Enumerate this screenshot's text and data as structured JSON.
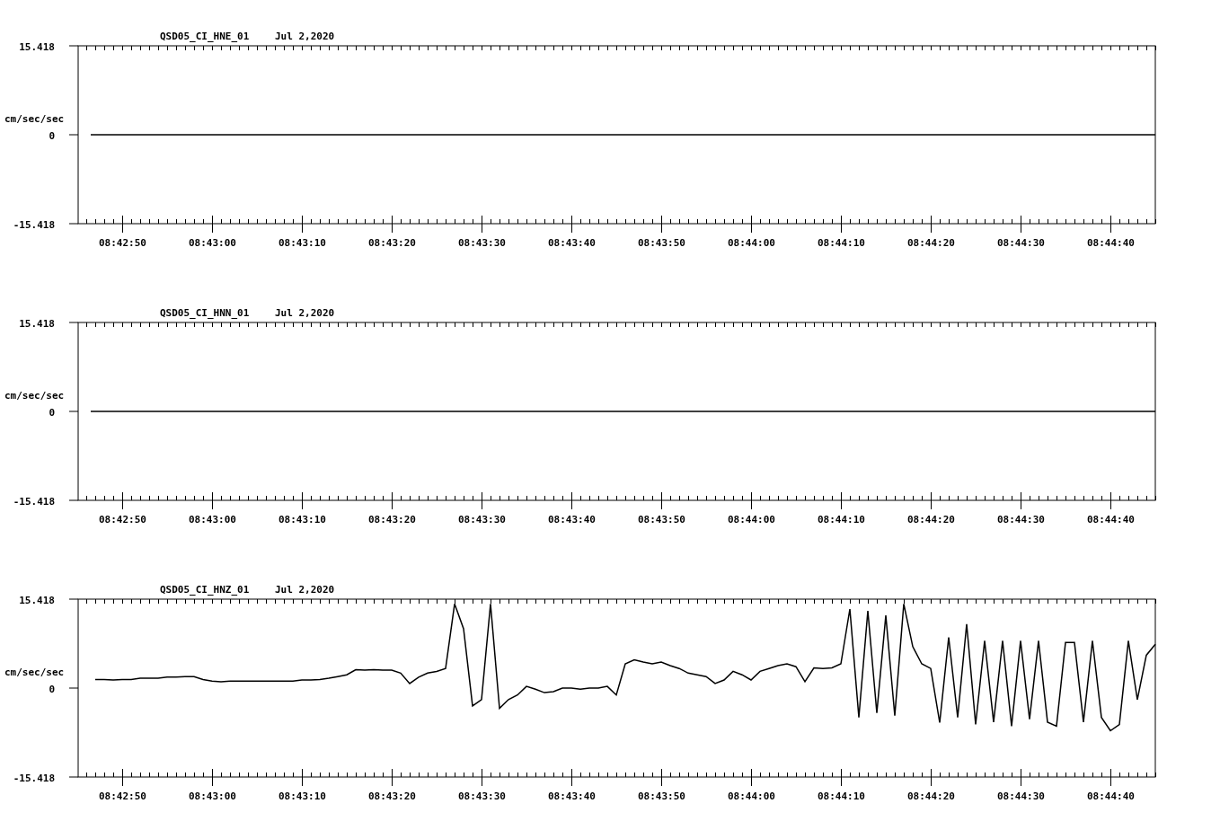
{
  "panels": [
    {
      "station": "QSD05_CI_HNE_01",
      "date": "Jul 2,2020",
      "chart_data": {
        "type": "line",
        "ylabel": "cm/sec/sec",
        "xlim": [
          31365.1,
          31485
        ],
        "ylim": [
          -15.418,
          15.418
        ],
        "yticks": [
          {
            "value": 15.418,
            "label": "15.418"
          },
          {
            "value": 0,
            "label": "0"
          },
          {
            "value": -15.418,
            "label": "-15.418"
          }
        ],
        "xticks": [
          {
            "value": 31370,
            "label": "08:42:50"
          },
          {
            "value": 31380,
            "label": "08:43:00"
          },
          {
            "value": 31390,
            "label": "08:43:10"
          },
          {
            "value": 31400,
            "label": "08:43:20"
          },
          {
            "value": 31410,
            "label": "08:43:30"
          },
          {
            "value": 31420,
            "label": "08:43:40"
          },
          {
            "value": 31430,
            "label": "08:43:50"
          },
          {
            "value": 31440,
            "label": "08:44:00"
          },
          {
            "value": 31450,
            "label": "08:44:10"
          },
          {
            "value": 31460,
            "label": "08:44:20"
          },
          {
            "value": 31470,
            "label": "08:44:30"
          },
          {
            "value": 31480,
            "label": "08:44:40"
          }
        ],
        "x": [
          31366.5,
          31485
        ],
        "series": [
          {
            "color": "#000000",
            "values": [
              0,
              0
            ]
          }
        ]
      }
    },
    {
      "station": "QSD05_CI_HNN_01",
      "date": "Jul 2,2020",
      "chart_data": {
        "type": "line",
        "ylabel": "cm/sec/sec",
        "xlim": [
          31365.1,
          31485
        ],
        "ylim": [
          -15.418,
          15.418
        ],
        "yticks": [
          {
            "value": 15.418,
            "label": "15.418"
          },
          {
            "value": 0,
            "label": "0"
          },
          {
            "value": -15.418,
            "label": "-15.418"
          }
        ],
        "xticks": [
          {
            "value": 31370,
            "label": "08:42:50"
          },
          {
            "value": 31380,
            "label": "08:43:00"
          },
          {
            "value": 31390,
            "label": "08:43:10"
          },
          {
            "value": 31400,
            "label": "08:43:20"
          },
          {
            "value": 31410,
            "label": "08:43:30"
          },
          {
            "value": 31420,
            "label": "08:43:40"
          },
          {
            "value": 31430,
            "label": "08:43:50"
          },
          {
            "value": 31440,
            "label": "08:44:00"
          },
          {
            "value": 31450,
            "label": "08:44:10"
          },
          {
            "value": 31460,
            "label": "08:44:20"
          },
          {
            "value": 31470,
            "label": "08:44:30"
          },
          {
            "value": 31480,
            "label": "08:44:40"
          }
        ],
        "x": [
          31366.5,
          31485
        ],
        "series": [
          {
            "color": "#000000",
            "values": [
              0,
              0
            ]
          }
        ]
      }
    },
    {
      "station": "QSD05_CI_HNZ_01",
      "date": "Jul 2,2020",
      "chart_data": {
        "type": "line",
        "ylabel": "cm/sec/sec",
        "xlim": [
          31365.1,
          31485
        ],
        "ylim": [
          -15.418,
          15.418
        ],
        "yticks": [
          {
            "value": 15.418,
            "label": "15.418"
          },
          {
            "value": 0,
            "label": "0"
          },
          {
            "value": -15.418,
            "label": "-15.418"
          }
        ],
        "xticks": [
          {
            "value": 31370,
            "label": "08:42:50"
          },
          {
            "value": 31380,
            "label": "08:43:00"
          },
          {
            "value": 31390,
            "label": "08:43:10"
          },
          {
            "value": 31400,
            "label": "08:43:20"
          },
          {
            "value": 31410,
            "label": "08:43:30"
          },
          {
            "value": 31420,
            "label": "08:43:40"
          },
          {
            "value": 31430,
            "label": "08:43:50"
          },
          {
            "value": 31440,
            "label": "08:44:00"
          },
          {
            "value": 31450,
            "label": "08:44:10"
          },
          {
            "value": 31460,
            "label": "08:44:20"
          },
          {
            "value": 31470,
            "label": "08:44:30"
          },
          {
            "value": 31480,
            "label": "08:44:40"
          }
        ],
        "x": [
          31367,
          31368,
          31369,
          31370,
          31371,
          31372,
          31373,
          31374,
          31375,
          31376,
          31377,
          31378,
          31379,
          31380,
          31381,
          31382,
          31383,
          31384,
          31385,
          31386,
          31387,
          31388,
          31389,
          31390,
          31391,
          31392,
          31393,
          31394,
          31395,
          31396,
          31397,
          31398,
          31399,
          31400,
          31401,
          31402,
          31403,
          31404,
          31405,
          31406,
          31407,
          31408,
          31409,
          31410,
          31411,
          31412,
          31413,
          31414,
          31415,
          31416,
          31417,
          31418,
          31419,
          31420,
          31421,
          31422,
          31423,
          31424,
          31425,
          31426,
          31427,
          31428,
          31429,
          31430,
          31431,
          31432,
          31433,
          31434,
          31435,
          31436,
          31437,
          31438,
          31439,
          31440,
          31441,
          31442,
          31443,
          31444,
          31445,
          31446,
          31447,
          31448,
          31449,
          31450,
          31451,
          31452,
          31453,
          31454,
          31455,
          31456,
          31457,
          31458,
          31459,
          31460,
          31461,
          31462,
          31463,
          31464,
          31465,
          31466,
          31467,
          31468,
          31469,
          31470,
          31471,
          31472,
          31473,
          31474,
          31475,
          31476,
          31477,
          31478,
          31479,
          31480,
          31481,
          31482,
          31483,
          31484,
          31485
        ],
        "series": [
          {
            "color": "#000000",
            "values": [
              1.5,
              1.5,
              1.4,
              1.5,
              1.5,
              1.7,
              1.7,
              1.7,
              1.9,
              1.9,
              2.0,
              2.0,
              1.5,
              1.2,
              1.1,
              1.2,
              1.2,
              1.2,
              1.2,
              1.2,
              1.2,
              1.2,
              1.2,
              1.4,
              1.4,
              1.5,
              1.7,
              2.0,
              2.3,
              3.2,
              3.1,
              3.2,
              3.1,
              3.1,
              2.6,
              0.8,
              1.9,
              2.6,
              2.9,
              3.4,
              14.6,
              10.3,
              -3.1,
              -2.0,
              14.6,
              -3.5,
              -2.0,
              -1.2,
              0.3,
              -0.2,
              -0.8,
              -0.6,
              0,
              0,
              -0.2,
              0,
              0,
              0.3,
              -1.2,
              4.2,
              4.9,
              4.5,
              4.2,
              4.5,
              3.9,
              3.4,
              2.6,
              2.3,
              2.0,
              0.8,
              1.4,
              2.9,
              2.3,
              1.4,
              2.9,
              3.4,
              3.9,
              4.2,
              3.7,
              1.1,
              3.5,
              3.4,
              3.5,
              4.2,
              13.7,
              -5.1,
              13.4,
              -4.3,
              12.6,
              -4.8,
              14.6,
              7.2,
              4.2,
              3.4,
              -6.0,
              8.8,
              -5.1,
              11.1,
              -6.3,
              8.2,
              -5.9,
              8.2,
              -6.6,
              8.2,
              -5.4,
              8.2,
              -5.9,
              -6.6,
              7.9,
              7.9,
              -5.9,
              8.2,
              -5.1,
              -7.4,
              -6.3,
              8.2,
              -2.0,
              5.7,
              7.6
            ]
          }
        ]
      }
    }
  ]
}
